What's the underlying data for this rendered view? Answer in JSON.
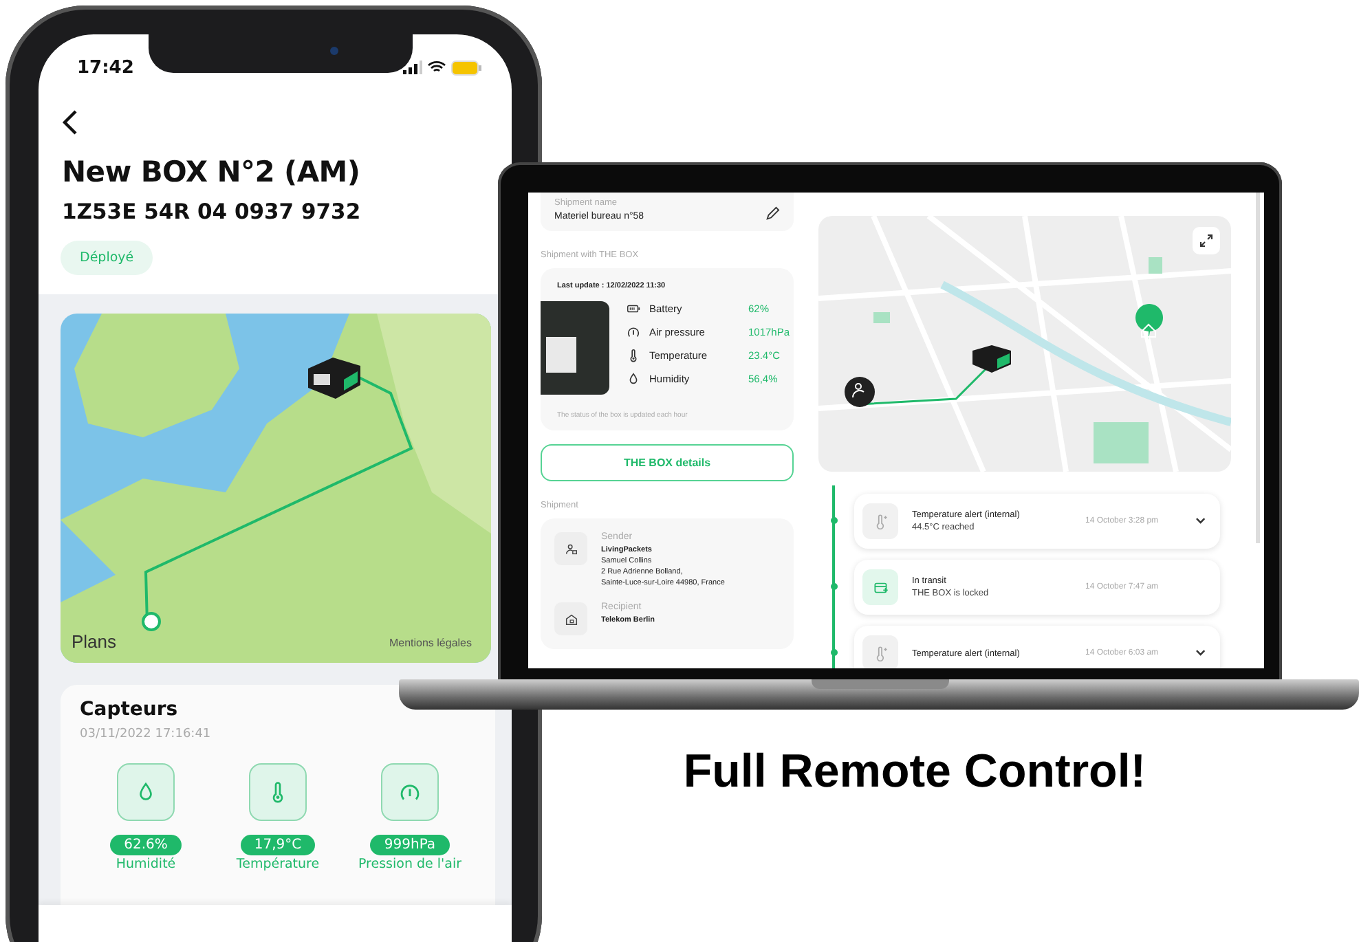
{
  "phone": {
    "status_bar": {
      "time": "17:42"
    },
    "title": "New BOX N°2 (AM)",
    "tracking_number": "1Z53E 54R 04 0937 9732",
    "status_badge": "Déployé",
    "map": {
      "attribution": "Plans",
      "legal_link": "Mentions légales"
    },
    "sensors": {
      "title": "Capteurs",
      "timestamp": "03/11/2022 17:16:41",
      "items": [
        {
          "kind": "humidity",
          "value": "62.6%",
          "label": "Humidité"
        },
        {
          "kind": "temperature",
          "value": "17,9°C",
          "label": "Température"
        },
        {
          "kind": "pressure",
          "value": "999hPa",
          "label": "Pression de l'air"
        }
      ]
    }
  },
  "laptop": {
    "shipment_name": {
      "label": "Shipment name",
      "value": "Materiel bureau n°58"
    },
    "box_section": {
      "heading": "Shipment with THE BOX",
      "last_update": "Last update : 12/02/2022 11:30",
      "metrics": [
        {
          "kind": "battery",
          "label": "Battery",
          "value": "62%"
        },
        {
          "kind": "pressure",
          "label": "Air pressure",
          "value": "1017hPa"
        },
        {
          "kind": "temperature",
          "label": "Temperature",
          "value": "23.4°C"
        },
        {
          "kind": "humidity",
          "label": "Humidity",
          "value": "56,4%"
        }
      ],
      "note": "The status of the box is updated each hour"
    },
    "details_button": "THE BOX details",
    "shipment": {
      "heading": "Shipment",
      "parties": [
        {
          "kind": "sender",
          "label": "Sender",
          "lines": [
            "LivingPackets",
            "Samuel Collins",
            "2 Rue Adrienne Bolland,",
            "Sainte-Luce-sur-Loire 44980, France"
          ]
        },
        {
          "kind": "recipient",
          "label": "Recipient",
          "lines": [
            "Telekom Berlin"
          ]
        }
      ]
    },
    "events": [
      {
        "kind": "alert",
        "title": "Temperature alert (internal)",
        "subtitle": "44.5°C reached",
        "time": "14 October 3:28 pm",
        "expandable": true
      },
      {
        "kind": "transit",
        "title": "In transit",
        "subtitle": "THE BOX is locked",
        "time": "14 October 7:47 am",
        "expandable": false
      },
      {
        "kind": "alert",
        "title": "Temperature alert (internal)",
        "time": "14 October 6:03 am",
        "expandable": true
      }
    ]
  },
  "caption": "Full Remote Control!"
}
